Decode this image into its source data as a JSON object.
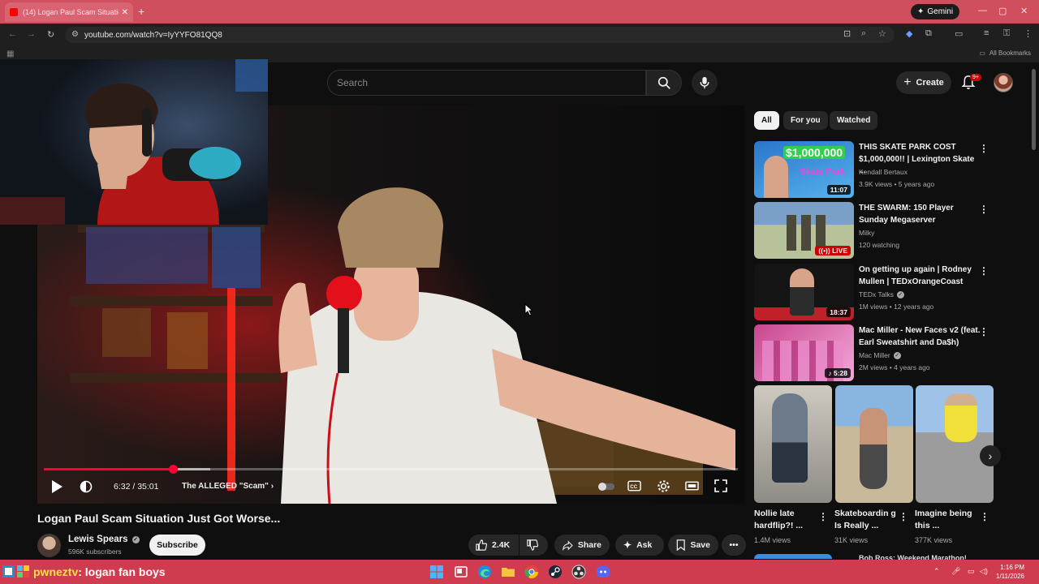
{
  "browser": {
    "tab_title": "(14) Logan Paul Scam Situation",
    "url": "youtube.com/watch?v=IyYYFO81QQ8",
    "gemini_label": "Gemini",
    "all_bookmarks": "All Bookmarks"
  },
  "masthead": {
    "search_placeholder": "Search",
    "create_label": "Create",
    "notification_count": "9+"
  },
  "player": {
    "current_time": "6:32",
    "duration": "35:01",
    "time_text": "6:32 / 35:01",
    "chapter": "The ALLEGED \"Scam\"",
    "progress_fraction": 0.1864,
    "buffered_fraction": 0.24
  },
  "video": {
    "title": "Logan Paul Scam Situation Just Got Worse...",
    "channel": "Lewis Spears",
    "subscribers": "596K subscribers",
    "subscribe_label": "Subscribe",
    "likes": "2.4K",
    "share_label": "Share",
    "ask_label": "Ask",
    "save_label": "Save"
  },
  "filters": [
    "All",
    "For you",
    "Watched"
  ],
  "recommendations": [
    {
      "title": "THIS SKATE PARK COST $1,000,000!! | Lexington Skate ...",
      "channel": "Kendall Bertaux",
      "meta": "3.9K views • 5 years ago",
      "duration": "11:07",
      "thumb_text_1": "$1,000,000",
      "thumb_text_2": "Skate Park",
      "colors": [
        "#2a76c9",
        "#56b2ee"
      ]
    },
    {
      "title": "THE SWARM: 150 Player Sunday Megaserver",
      "channel": "Milky",
      "meta": "120 watching",
      "badge": "LIVE",
      "colors": [
        "#7aa0c8",
        "#b8c29a"
      ]
    },
    {
      "title": "On getting up again | Rodney Mullen | TEDxOrangeCoast",
      "channel": "TEDx Talks",
      "meta": "1M views • 12 years ago",
      "duration": "18:37",
      "colors": [
        "#141414",
        "#3a2a25"
      ]
    },
    {
      "title": "Mac Miller - New Faces v2 (feat. Earl Sweatshirt and Da$h)",
      "channel": "Mac Miller",
      "meta": "2M views • 4 years ago",
      "duration": "5:28",
      "colors": [
        "#c8468e",
        "#f3a7d9"
      ]
    }
  ],
  "shorts": [
    {
      "title": "Nollie late hardflip?! ...",
      "views": "1.4M views",
      "colors": [
        "#cfcac0",
        "#8f8b86"
      ]
    },
    {
      "title": "Skateboardin g Is Really ...",
      "views": "31K views",
      "colors": [
        "#88b6e0",
        "#c9b99b"
      ]
    },
    {
      "title": "Imagine being this ...",
      "views": "377K views",
      "colors": [
        "#9fc2e8",
        "#9c9c9c"
      ]
    }
  ],
  "peek_title": "Bob Ross: Weekend Marathon!",
  "stream_overlay": {
    "user": "pwneztv",
    "message": ": logan fan boys"
  },
  "clock": {
    "time": "1:16 PM",
    "date": "1/11/2026"
  }
}
